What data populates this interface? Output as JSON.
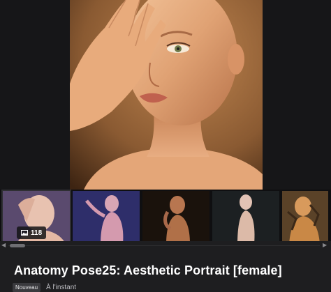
{
  "gallery": {
    "image_count": "118",
    "count_icon": "image-icon"
  },
  "post": {
    "title": "Anatomy Pose25: Aesthetic Portrait [female]",
    "badge": "Nouveau",
    "time": "À l'instant"
  },
  "colors": {
    "background": "#1e1e20",
    "skin": "#d99a6c",
    "backdrop": "#8a5a32"
  }
}
